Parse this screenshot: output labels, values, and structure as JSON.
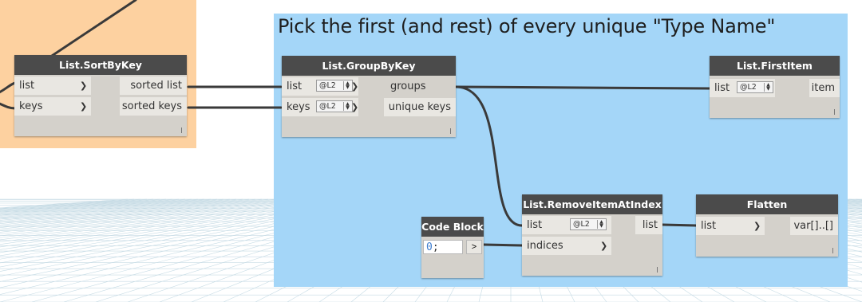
{
  "group_main": {
    "title": "Pick the first (and rest) of every unique \"Type Name\""
  },
  "nodes": {
    "sort_by_key": {
      "title": "List.SortByKey",
      "inputs": [
        "list",
        "keys"
      ],
      "outputs": [
        "sorted list",
        "sorted keys"
      ]
    },
    "group_by_key": {
      "title": "List.GroupByKey",
      "inputs": [
        "list",
        "keys"
      ],
      "lacing": [
        "@L2",
        "@L2"
      ],
      "outputs": [
        "groups",
        "unique keys"
      ]
    },
    "first_item": {
      "title": "List.FirstItem",
      "inputs": [
        "list"
      ],
      "lacing": [
        "@L2"
      ],
      "outputs": [
        "item"
      ]
    },
    "remove_item_at_index": {
      "title": "List.RemoveItemAtIndex",
      "inputs": [
        "list",
        "indices"
      ],
      "lacing": [
        "@L2"
      ],
      "outputs": [
        "list"
      ]
    },
    "flatten": {
      "title": "Flatten",
      "inputs": [
        "list"
      ],
      "outputs": [
        "var[]..[]"
      ]
    },
    "code_block": {
      "title": "Code Block",
      "code_value": "0",
      "code_punct": ";",
      "output_glyph": ">"
    }
  },
  "colors": {
    "group_left": "#fdd1a0",
    "group_main": "#a4d6f8",
    "node_header": "#4b4b4b",
    "node_body": "#d4d1cb",
    "wire": "#3a3a3a"
  },
  "icons": {
    "port_chevron": "chevron-right-icon",
    "lacing_spinner": "spinner-arrows-icon"
  }
}
